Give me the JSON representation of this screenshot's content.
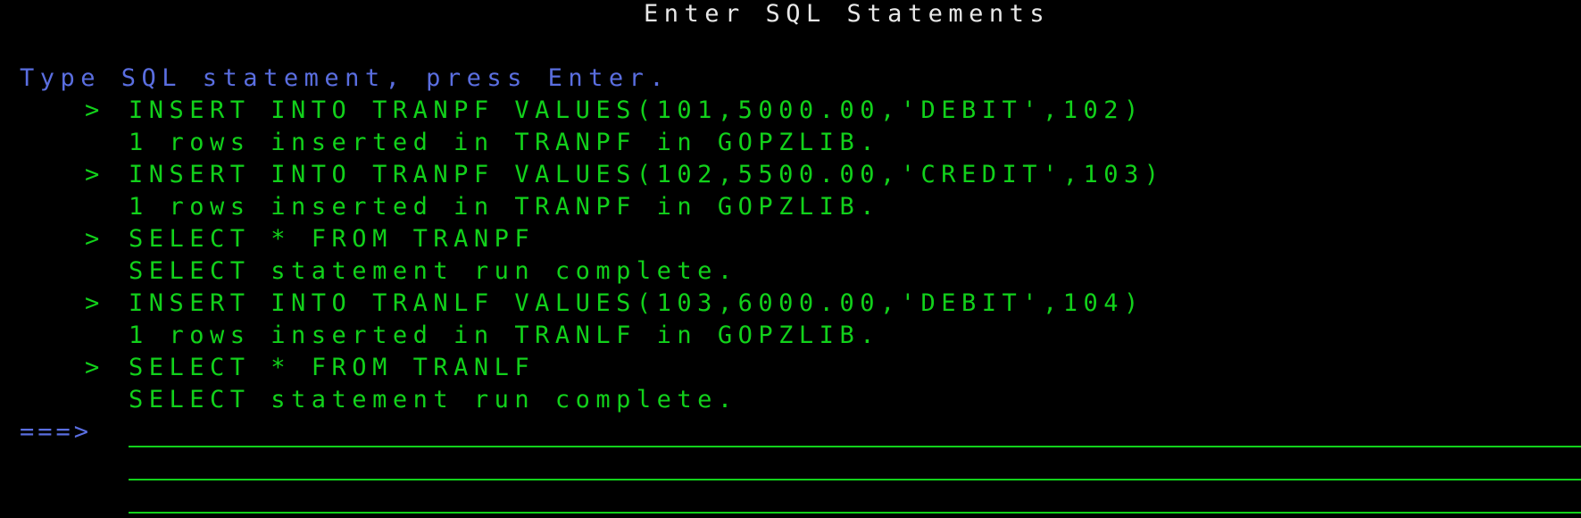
{
  "screen": {
    "title": "Enter SQL Statements",
    "instruction": "Type SQL statement, press Enter.",
    "command_marker": "===>",
    "history_arrow": ">"
  },
  "history": [
    {
      "statement": "INSERT INTO TRANPF VALUES(101,5000.00,'DEBIT',102)",
      "message": "1 rows inserted in TRANPF in GOPZLIB."
    },
    {
      "statement": "INSERT INTO TRANPF VALUES(102,5500.00,'CREDIT',103)",
      "message": "1 rows inserted in TRANPF in GOPZLIB."
    },
    {
      "statement": "SELECT * FROM TRANPF",
      "message": "SELECT statement run complete."
    },
    {
      "statement": "INSERT INTO TRANLF VALUES(103,6000.00,'DEBIT',104)",
      "message": "1 rows inserted in TRANLF in GOPZLIB."
    },
    {
      "statement": "SELECT * FROM TRANLF",
      "message": "SELECT statement run complete."
    }
  ],
  "input": {
    "line1": "",
    "line2": "",
    "line3": ""
  },
  "colors": {
    "background": "#000000",
    "green": "#12d11b",
    "blue": "#5a6ee0",
    "white": "#e8e8e8"
  }
}
